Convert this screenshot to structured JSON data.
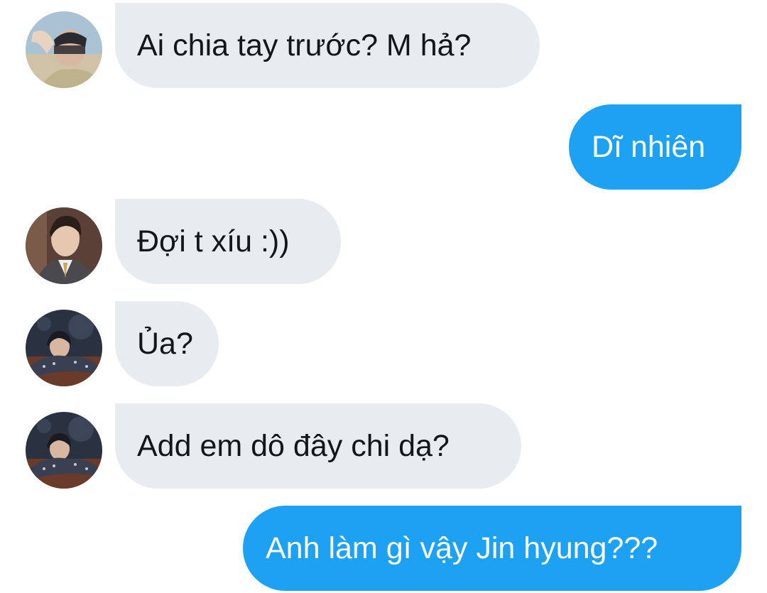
{
  "messages": [
    {
      "direction": "incoming",
      "sender_avatar": "avatar-sunlight-photo",
      "text": "Ai chia tay trước? M hả?"
    },
    {
      "direction": "outgoing",
      "text": "Dĩ nhiên"
    },
    {
      "direction": "incoming",
      "sender_avatar": "avatar-man-in-suit-photo",
      "text": "Đợi t xíu :))"
    },
    {
      "direction": "incoming",
      "sender_avatar": "avatar-dark-room-photo",
      "text": "Ủa?"
    },
    {
      "direction": "incoming",
      "sender_avatar": "avatar-dark-room-photo",
      "text": "Add em dô đây chi dạ?"
    },
    {
      "direction": "outgoing",
      "text": "Anh làm gì vậy Jin hyung???"
    }
  ],
  "colors": {
    "incoming_bubble": "#e7ecf0",
    "outgoing_bubble": "#1da1f2",
    "incoming_text": "#14171a",
    "outgoing_text": "#ffffff",
    "background": "#ffffff"
  }
}
